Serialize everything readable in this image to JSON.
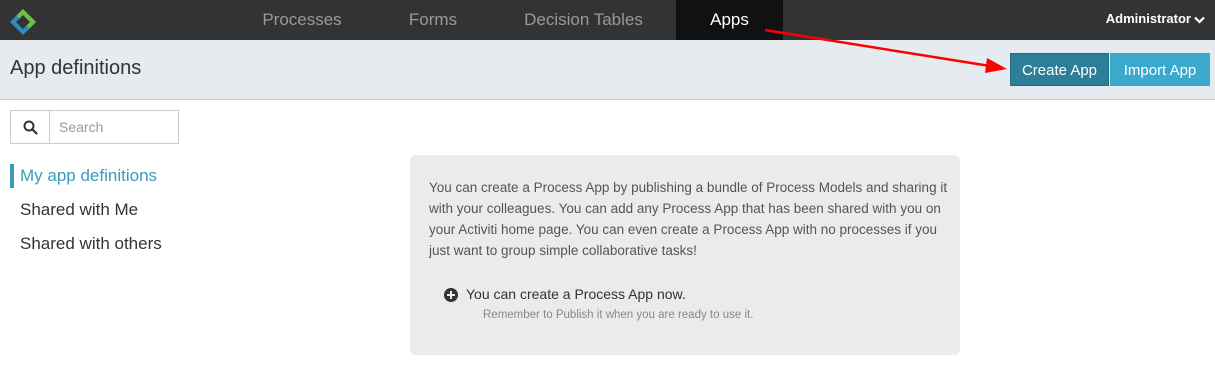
{
  "nav": {
    "items": [
      {
        "label": "Processes"
      },
      {
        "label": "Forms"
      },
      {
        "label": "Decision Tables"
      },
      {
        "label": "Apps"
      }
    ],
    "user": "Administrator"
  },
  "header": {
    "title": "App definitions",
    "create_label": "Create App",
    "import_label": "Import App"
  },
  "search": {
    "placeholder": "Search"
  },
  "sidebar": {
    "items": [
      {
        "label": "My app definitions"
      },
      {
        "label": "Shared with Me"
      },
      {
        "label": "Shared with others"
      }
    ]
  },
  "panel": {
    "description": "You can create a Process App by publishing a bundle of Process Models and sharing it with your colleagues. You can add any Process App that has been shared with you on your Activiti home page. You can even create a Process App with no processes if you just want to group simple collaborative tasks!",
    "action_text": "You can create a Process App now.",
    "hint_text": "Remember to Publish it when you are ready to use it."
  },
  "colors": {
    "topbar": "#333333",
    "accent": "#3a9cbd",
    "create_button": "#2c7e99",
    "import_button": "#3aa9cc",
    "annotation_arrow": "#ff0000"
  }
}
